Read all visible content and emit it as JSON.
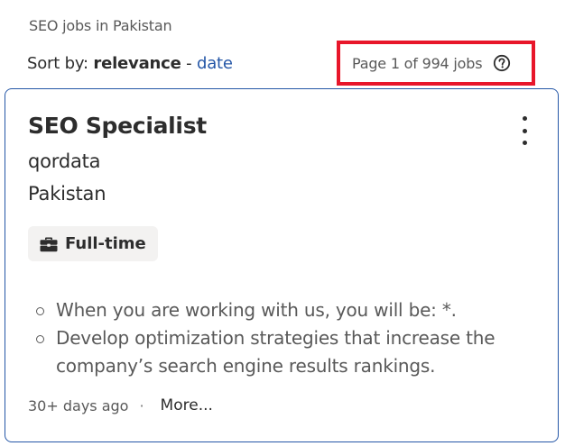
{
  "search": {
    "heading": "SEO jobs in Pakistan"
  },
  "sort": {
    "label": "Sort by:",
    "active": "relevance",
    "separator": " - ",
    "alternative": "date"
  },
  "pagination": {
    "text": "Page 1 of 994 jobs",
    "help_icon": "question-circle-icon",
    "highlight_color": "#e8162a"
  },
  "job": {
    "title": "SEO Specialist",
    "company": "qordata",
    "location": "Pakistan",
    "job_type": "Full-time",
    "job_type_icon": "briefcase-icon",
    "menu_icon": "more-vertical-icon",
    "snippet": [
      "When you are working with us, you will be: *.",
      "Develop optimization strategies that increase the company’s search engine results rankings."
    ],
    "posted": "30+ days ago",
    "separator": "·",
    "more_label": "More..."
  },
  "colors": {
    "accent": "#2557a7",
    "text": "#2d2d2d",
    "muted": "#595959",
    "badge_bg": "#f3f2f1"
  }
}
